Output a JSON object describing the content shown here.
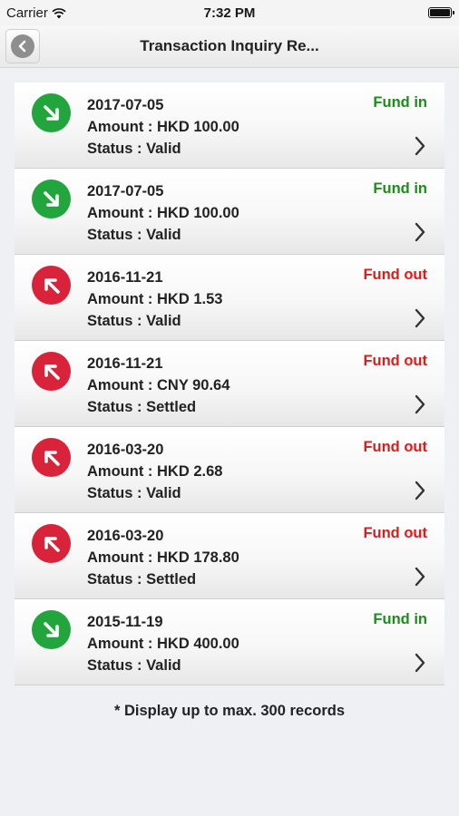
{
  "status_bar": {
    "carrier": "Carrier",
    "time": "7:32 PM"
  },
  "nav": {
    "title": "Transaction Inquiry Re..."
  },
  "transactions": [
    {
      "date": "2017-07-05",
      "amount": "Amount : HKD 100.00",
      "status": "Status : Valid",
      "type": "Fund in",
      "direction": "in"
    },
    {
      "date": "2017-07-05",
      "amount": "Amount : HKD 100.00",
      "status": "Status : Valid",
      "type": "Fund in",
      "direction": "in"
    },
    {
      "date": "2016-11-21",
      "amount": "Amount : HKD 1.53",
      "status": "Status : Valid",
      "type": "Fund out",
      "direction": "out"
    },
    {
      "date": "2016-11-21",
      "amount": "Amount : CNY 90.64",
      "status": "Status : Settled",
      "type": "Fund out",
      "direction": "out"
    },
    {
      "date": "2016-03-20",
      "amount": "Amount : HKD 2.68",
      "status": "Status : Valid",
      "type": "Fund out",
      "direction": "out"
    },
    {
      "date": "2016-03-20",
      "amount": "Amount : HKD 178.80",
      "status": "Status : Settled",
      "type": "Fund out",
      "direction": "out"
    },
    {
      "date": "2015-11-19",
      "amount": "Amount : HKD 400.00",
      "status": "Status : Valid",
      "type": "Fund in",
      "direction": "in"
    }
  ],
  "footer": {
    "note": "* Display up to max. 300 records"
  },
  "colors": {
    "fund_in": "#21a53c",
    "fund_out": "#d8233a"
  },
  "icons": {
    "fund_in": "arrow-down-right-icon",
    "fund_out": "arrow-up-left-icon",
    "row_action": "chevron-right-icon"
  }
}
